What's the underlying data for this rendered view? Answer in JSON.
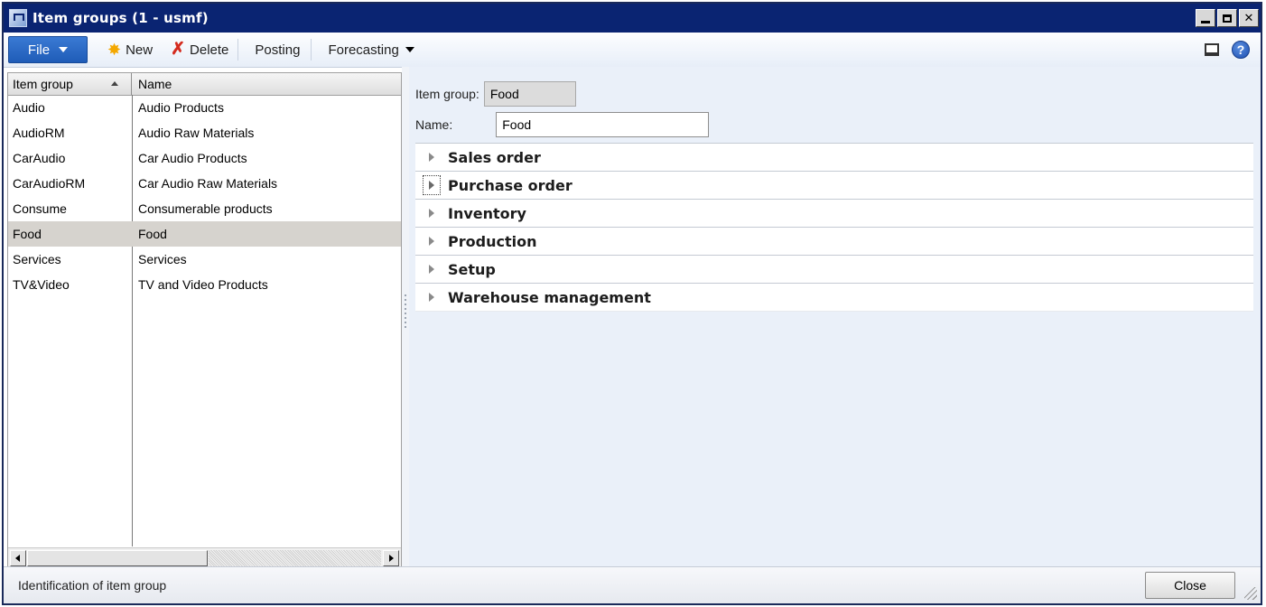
{
  "window": {
    "title": "Item groups (1 - usmf)",
    "icon": "app-window-icon"
  },
  "toolbar": {
    "file_label": "File",
    "new_label": "New",
    "delete_label": "Delete",
    "posting_label": "Posting",
    "forecasting_label": "Forecasting"
  },
  "grid": {
    "columns": [
      "Item group",
      "Name"
    ],
    "sort": "ascending",
    "rows": [
      {
        "item_group": "Audio",
        "name": "Audio Products"
      },
      {
        "item_group": "AudioRM",
        "name": "Audio Raw Materials"
      },
      {
        "item_group": "CarAudio",
        "name": "Car Audio Products"
      },
      {
        "item_group": "CarAudioRM",
        "name": "Car Audio Raw Materials"
      },
      {
        "item_group": "Consume",
        "name": "Consumerable products"
      },
      {
        "item_group": "Food",
        "name": "Food"
      },
      {
        "item_group": "Services",
        "name": "Services"
      },
      {
        "item_group": "TV&Video",
        "name": "TV and Video Products"
      }
    ],
    "selected_index": 5
  },
  "details": {
    "item_group_label": "Item group:",
    "item_group_value": "Food",
    "name_label": "Name:",
    "name_value": "Food",
    "fasttabs": [
      "Sales order",
      "Purchase order",
      "Inventory",
      "Production",
      "Setup",
      "Warehouse management"
    ]
  },
  "status": {
    "text": "Identification of item group",
    "close_label": "Close"
  },
  "colors": {
    "titlebar": "#0a2472",
    "file_button": "#2a6bc8",
    "details_bg": "#eaf0f9",
    "selected_row": "#d6d3ce"
  }
}
